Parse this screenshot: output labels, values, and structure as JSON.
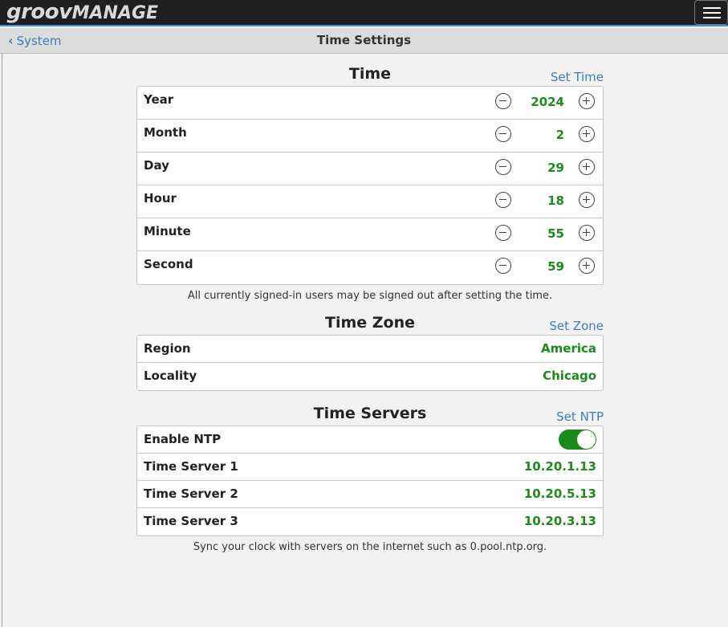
{
  "app": {
    "brand": "groov",
    "product": "MANAGE"
  },
  "nav": {
    "back_label": "System",
    "title": "Time Settings"
  },
  "time": {
    "title": "Time",
    "action": "Set Time",
    "rows": [
      {
        "label": "Year",
        "value": "2024"
      },
      {
        "label": "Month",
        "value": "2"
      },
      {
        "label": "Day",
        "value": "29"
      },
      {
        "label": "Hour",
        "value": "18"
      },
      {
        "label": "Minute",
        "value": "55"
      },
      {
        "label": "Second",
        "value": "59"
      }
    ],
    "note": "All currently signed-in users may be signed out after setting the time."
  },
  "zone": {
    "title": "Time Zone",
    "action": "Set Zone",
    "rows": [
      {
        "label": "Region",
        "value": "America"
      },
      {
        "label": "Locality",
        "value": "Chicago"
      }
    ]
  },
  "servers": {
    "title": "Time Servers",
    "action": "Set NTP",
    "ntp_label": "Enable NTP",
    "ntp_enabled": true,
    "rows": [
      {
        "label": "Time Server 1",
        "value": "10.20.1.13"
      },
      {
        "label": "Time Server 2",
        "value": "10.20.5.13"
      },
      {
        "label": "Time Server 3",
        "value": "10.20.3.13"
      }
    ],
    "note": "Sync your clock with servers on the internet such as 0.pool.ntp.org."
  },
  "colors": {
    "accent": "#3a7ec1",
    "value_green": "#1e8a1e",
    "topbar": "#1f1f1f"
  },
  "icons": {
    "back": "chevron-left-icon",
    "menu": "hamburger-menu-icon",
    "decrement": "minus-circle-icon",
    "increment": "plus-circle-icon"
  }
}
